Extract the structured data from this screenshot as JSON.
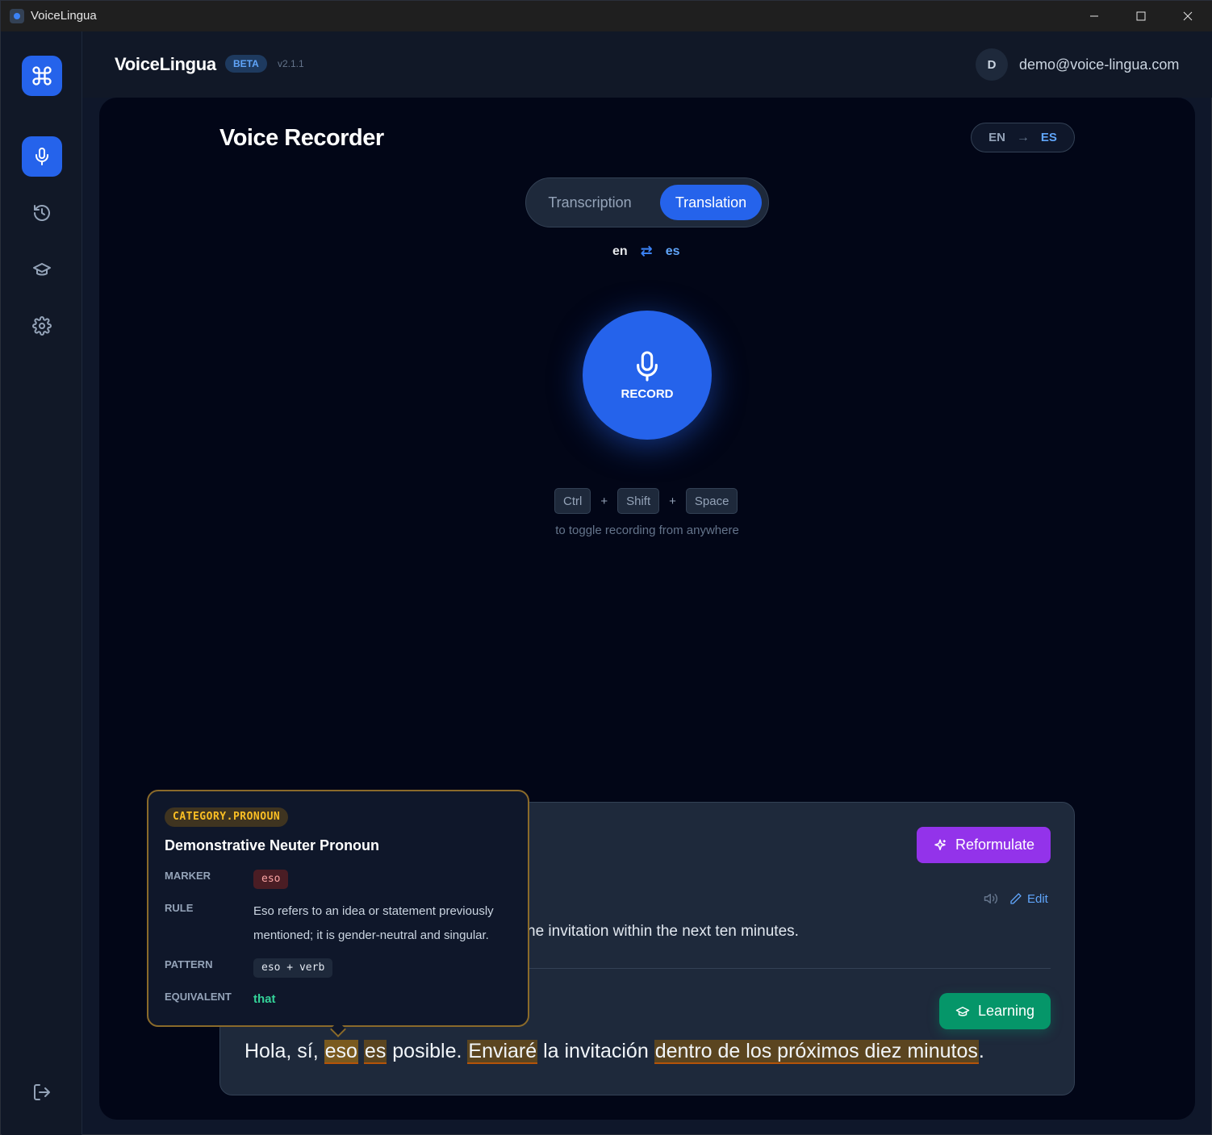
{
  "window": {
    "title": "VoiceLingua"
  },
  "header": {
    "brand": "VoiceLingua",
    "badge": "BETA",
    "version": "v2.1.1",
    "avatar_initial": "D",
    "email": "demo@voice-lingua.com"
  },
  "sidebar": {
    "items": [
      {
        "name": "logo",
        "icon": "command-icon"
      },
      {
        "name": "record",
        "icon": "mic-icon",
        "active": true
      },
      {
        "name": "history",
        "icon": "history-icon"
      },
      {
        "name": "learning",
        "icon": "graduation-cap-icon"
      },
      {
        "name": "settings",
        "icon": "gear-icon"
      },
      {
        "name": "logout",
        "icon": "logout-icon"
      }
    ]
  },
  "page": {
    "title": "Voice Recorder",
    "lang_source": "EN",
    "lang_target": "ES"
  },
  "mode": {
    "options": [
      "Transcription",
      "Translation"
    ],
    "selected": "Translation"
  },
  "pair": {
    "source": "en",
    "target": "es"
  },
  "record": {
    "label": "RECORD"
  },
  "shortcut": {
    "keys": [
      "Ctrl",
      "Shift",
      "Space"
    ],
    "separator": "+",
    "hint": "to toggle recording from anywhere"
  },
  "result": {
    "reformulate_label": "Reformulate",
    "edit_label": "Edit",
    "source_text_visible": "he invitation within the next ten minutes.",
    "learning_label": "Learning",
    "target_segments": [
      {
        "text": "Hola, sí, ",
        "highlight": false
      },
      {
        "text": "eso",
        "highlight": true,
        "selected": true
      },
      {
        "text": " ",
        "highlight": false
      },
      {
        "text": "es",
        "highlight": true
      },
      {
        "text": " posible. ",
        "highlight": false
      },
      {
        "text": "Enviaré",
        "highlight": true
      },
      {
        "text": " la invitación ",
        "highlight": false
      },
      {
        "text": "dentro de los próximos diez minutos",
        "highlight": true
      },
      {
        "text": ".",
        "highlight": false
      }
    ]
  },
  "tooltip": {
    "category": "CATEGORY.PRONOUN",
    "title": "Demonstrative Neuter Pronoun",
    "marker_label": "MARKER",
    "marker": "eso",
    "rule_label": "RULE",
    "rule_line1": "Eso refers to an idea or statement previously",
    "rule_line2": "mentioned; it is gender-neutral and singular.",
    "pattern_label": "PATTERN",
    "pattern": "eso + verb",
    "equivalent_label": "EQUIVALENT",
    "equivalent": "that"
  },
  "colors": {
    "accent": "#2563eb",
    "reformulate": "#9333ea",
    "learning": "#059669",
    "highlight": "#b45309",
    "tooltip_border": "#8a6a2a"
  }
}
